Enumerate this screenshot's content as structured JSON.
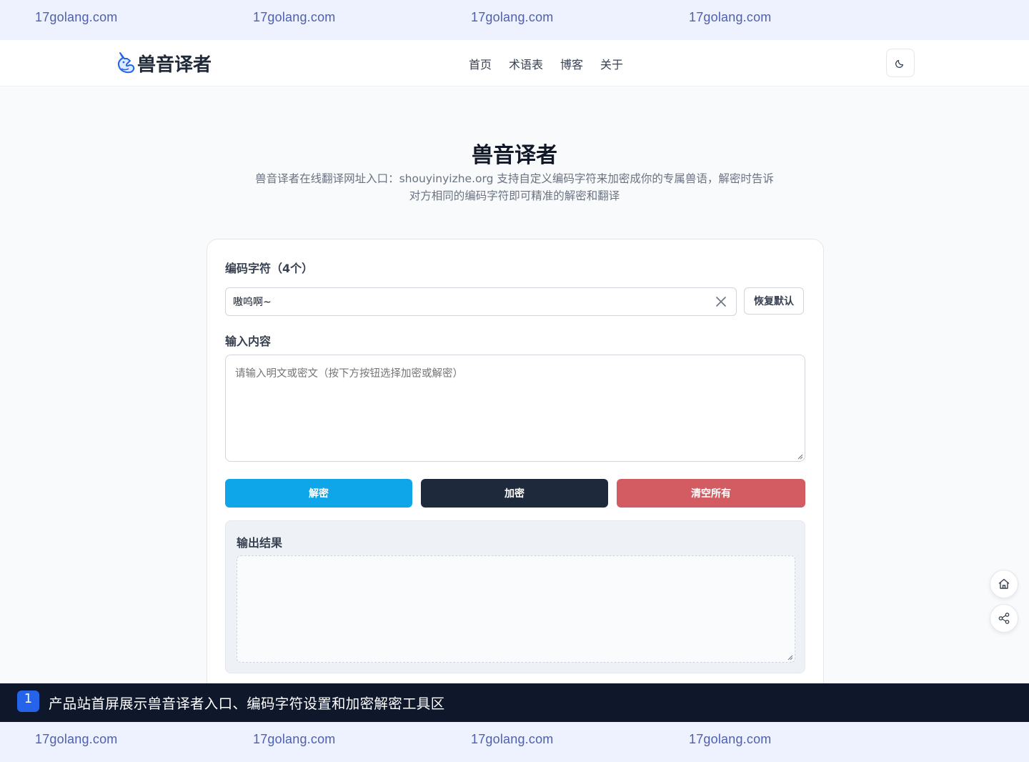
{
  "watermark": {
    "text": "17golang.com"
  },
  "nav": {
    "logo_text": "兽音译者",
    "items": [
      "首页",
      "术语表",
      "博客",
      "关于"
    ]
  },
  "hero": {
    "title": "兽音译者",
    "subtitle": "兽音译者在线翻译网址入口：shouyinyizhe.org 支持自定义编码字符来加密成你的专属兽语，解密时告诉对方相同的编码字符即可精准的解密和翻译"
  },
  "form": {
    "code_label": "编码字符（4个）",
    "code_value": "嗷呜啊~",
    "reset_label": "恢复默认",
    "input_label": "输入内容",
    "input_placeholder": "请输入明文或密文（按下方按钮选择加密或解密）",
    "decrypt_label": "解密",
    "encrypt_label": "加密",
    "clear_label": "清空所有",
    "output_label": "输出结果"
  },
  "caption": {
    "number": "1",
    "text": "产品站首屏展示兽音译者入口、编码字符设置和加密解密工具区"
  },
  "colors": {
    "decrypt": "#0ea5e9",
    "encrypt": "#1e293b",
    "clear": "#d35c63",
    "caption_badge": "#2563eb"
  },
  "icons": {
    "logo": "unicorn-icon",
    "theme": "moon-icon",
    "clear": "close-icon",
    "home": "home-icon",
    "share": "share-icon"
  }
}
